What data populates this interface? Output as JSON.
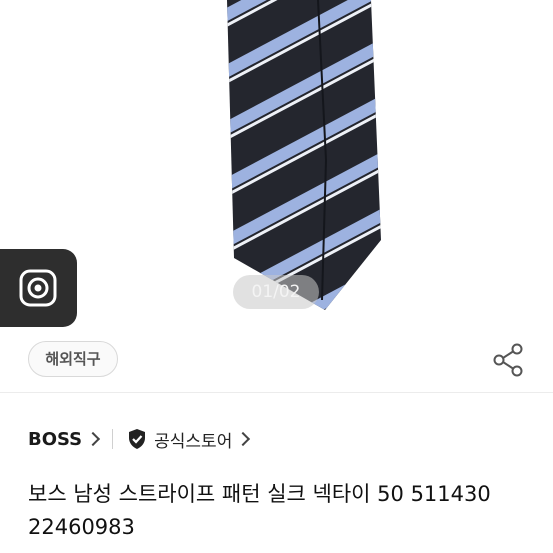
{
  "gallery": {
    "page_indicator": "01/02"
  },
  "badge": {
    "overseas_label": "해외직구"
  },
  "brand": {
    "name": "BOSS",
    "store_label": "공식스토어"
  },
  "product": {
    "title": "보스 남성 스트라이프 패턴 실크 넥타이 50 511430 22460983"
  },
  "colors": {
    "tie_base": "#24262e",
    "stripe_light": "#9db2e0",
    "stripe_white": "#eef1f7",
    "camera_bg": "#2e2e2e"
  },
  "icons": {
    "camera": "camera-icon",
    "share": "share-icon",
    "shield": "shield-check-icon"
  }
}
